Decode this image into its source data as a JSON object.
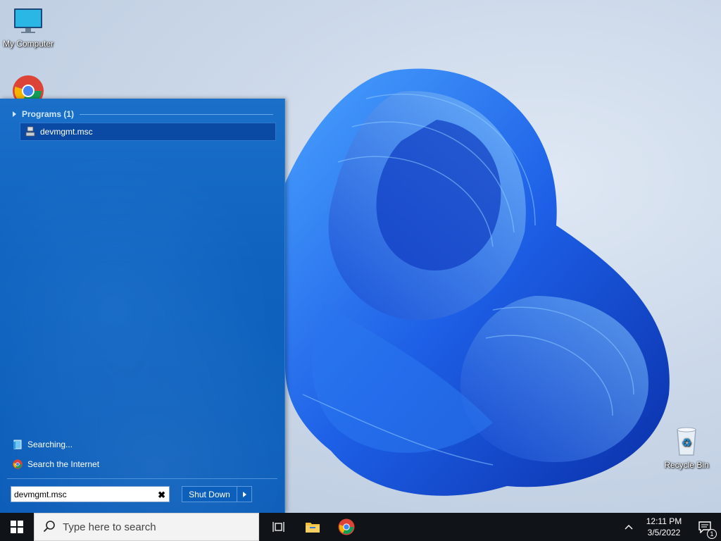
{
  "desktop": {
    "icons": [
      {
        "label": "My Computer",
        "icon": "monitor-icon"
      },
      {
        "label": "",
        "icon": "chrome-icon"
      },
      {
        "label": "Recycle Bin",
        "icon": "recycle-bin-icon"
      }
    ]
  },
  "start_menu": {
    "programs_header": "Programs (1)",
    "results": [
      {
        "label": "devmgmt.msc",
        "icon": "device-manager-icon"
      }
    ],
    "searching_label": "Searching...",
    "search_internet_label": "Search the Internet",
    "search_value": "devmgmt.msc",
    "shutdown_label": "Shut Down"
  },
  "taskbar": {
    "search_placeholder": "Type here to search",
    "clock_time": "12:11 PM",
    "clock_date": "3/5/2022",
    "notification_count": "1",
    "pinned": [
      "task-view-icon",
      "file-explorer-icon",
      "chrome-icon"
    ]
  },
  "colors": {
    "start_menu_bg": "#0f63bf",
    "selected_item_bg": "#0a4aa4",
    "taskbar_bg": "#101418",
    "wallpaper_bloom": "#1f5fe0"
  }
}
